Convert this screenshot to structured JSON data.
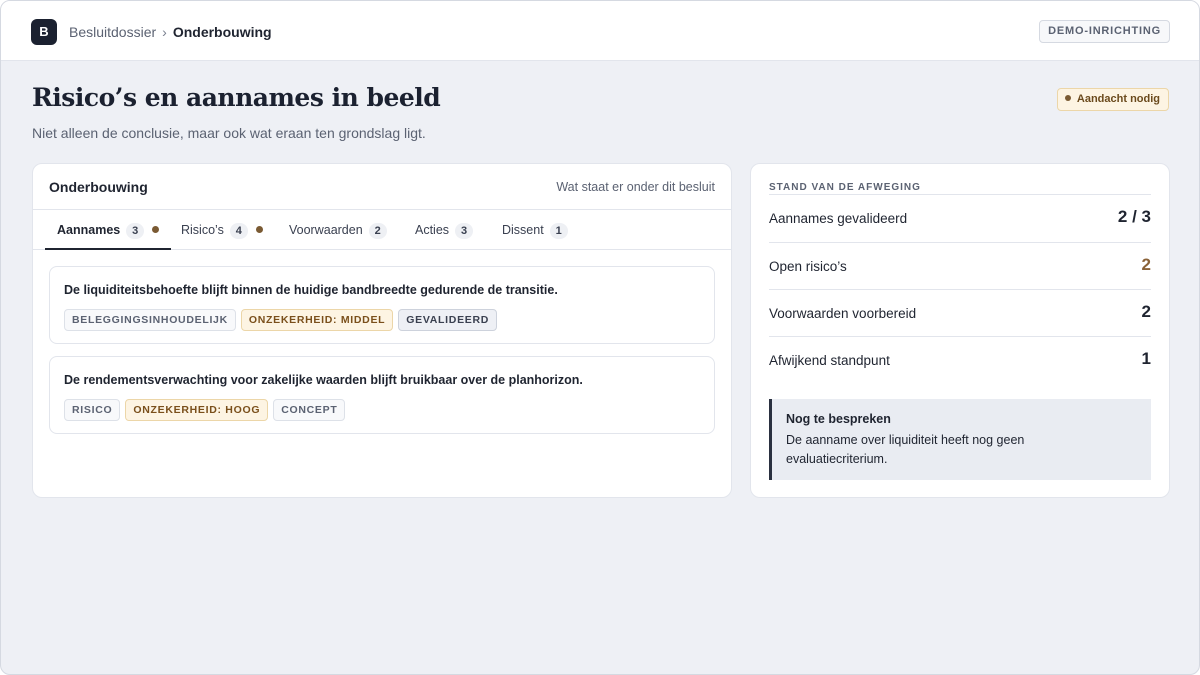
{
  "header": {
    "logo_letter": "B",
    "breadcrumb_parent": "Besluitdossier",
    "breadcrumb_separator": "›",
    "breadcrumb_current": "Onderbouwing",
    "environment_badge": "DEMO-INRICHTING"
  },
  "page": {
    "title": "Risico’s en aannames in beeld",
    "subtitle": "Niet alleen de conclusie, maar ook wat eraan ten grondslag ligt.",
    "status_badge": "Aandacht nodig"
  },
  "panel": {
    "title": "Onderbouwing",
    "hint": "Wat staat er onder dit besluit",
    "tabs": [
      {
        "label": "Aannames",
        "count": "3",
        "flag": true,
        "active": true
      },
      {
        "label": "Risico’s",
        "count": "4",
        "flag": true,
        "active": false
      },
      {
        "label": "Voorwaarden",
        "count": "2",
        "flag": false,
        "active": false
      },
      {
        "label": "Acties",
        "count": "3",
        "flag": false,
        "active": false
      },
      {
        "label": "Dissent",
        "count": "1",
        "flag": false,
        "active": false
      }
    ],
    "items": [
      {
        "text": "De liquiditeitsbehoefte blijft binnen de huidige bandbreedte gedurende de transitie.",
        "tags": [
          "BELEGGINGSINHOUDELIJK",
          "ONZEKERHEID: MIDDEL",
          "GEVALIDEERD"
        ]
      },
      {
        "text": "De rendementsverwachting voor zakelijke waarden blijft bruikbaar over de planhorizon.",
        "tags": [
          "RISICO",
          "ONZEKERHEID: HOOG",
          "CONCEPT"
        ]
      }
    ]
  },
  "sidebar": {
    "heading": "STAND VAN DE AFWEGING",
    "stats": [
      {
        "label": "Aannames gevalideerd",
        "value": "2 / 3"
      },
      {
        "label": "Open risico’s",
        "value": "2"
      },
      {
        "label": "Voorwaarden voorbereid",
        "value": "2"
      },
      {
        "label": "Afwijkend standpunt",
        "value": "1"
      }
    ],
    "note_title": "Nog te bespreken",
    "note_text": "De aanname over liquiditeit heeft nog geen evaluatiecriterium."
  },
  "colors": {
    "accent_dark": "#1b2130",
    "warning": "#8a6238",
    "warning_bg": "#fdf4e3"
  }
}
